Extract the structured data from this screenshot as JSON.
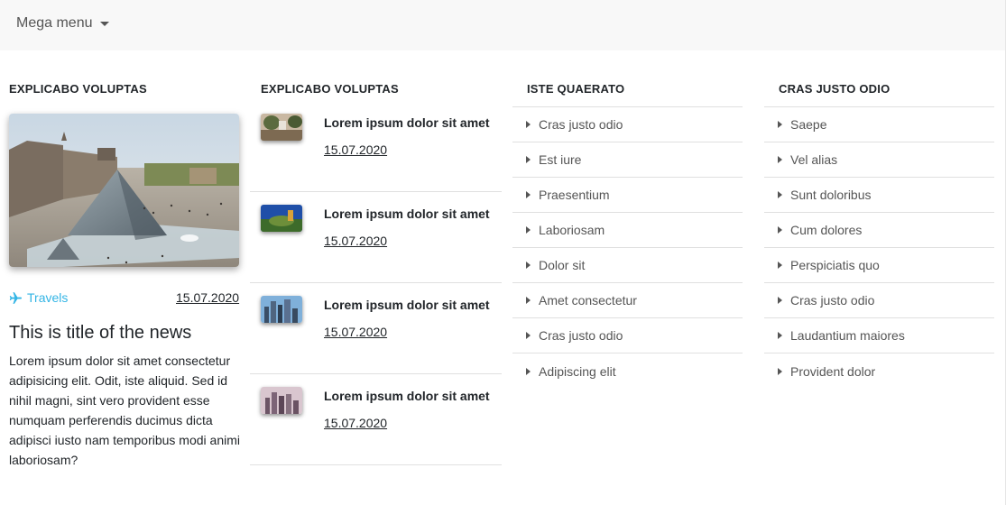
{
  "navbar": {
    "toggle_label": "Mega menu"
  },
  "columns": {
    "featured": {
      "title": "Explicabo voluptas",
      "category": "Travels",
      "date": "15.07.2020",
      "news_title": "This is title of the news",
      "news_text": "Lorem ipsum dolor sit amet consectetur adipisicing elit. Odit, iste aliquid. Sed id nihil magni, sint vero provident esse numquam perferendis ducimus dicta adipisci iusto nam temporibus modi animi laboriosam?"
    },
    "news": {
      "title": "Explicabo voluptas",
      "items": [
        {
          "title": "Lorem ipsum dolor sit amet",
          "date": "15.07.2020"
        },
        {
          "title": "Lorem ipsum dolor sit amet",
          "date": "15.07.2020"
        },
        {
          "title": "Lorem ipsum dolor sit amet",
          "date": "15.07.2020"
        },
        {
          "title": "Lorem ipsum dolor sit amet",
          "date": "15.07.2020"
        }
      ]
    },
    "list1": {
      "title": "Iste quaerato",
      "items": [
        "Cras justo odio",
        "Est iure",
        "Praesentium",
        "Laboriosam",
        "Dolor sit",
        "Amet consectetur",
        "Cras justo odio",
        "Adipiscing elit"
      ]
    },
    "list2": {
      "title": "Cras justo odio",
      "items": [
        "Saepe",
        "Vel alias",
        "Sunt doloribus",
        "Cum dolores",
        "Perspiciatis quo",
        "Cras justo odio",
        "Laudantium maiores",
        "Provident dolor"
      ]
    }
  },
  "colors": {
    "accent": "#33b5e5",
    "text": "#212529",
    "link": "#555555",
    "navbar_bg": "#f8f8f8"
  },
  "icons": {
    "category": "plane-icon",
    "list_bullet": "caret-right-icon",
    "toggle": "caret-down-icon"
  }
}
